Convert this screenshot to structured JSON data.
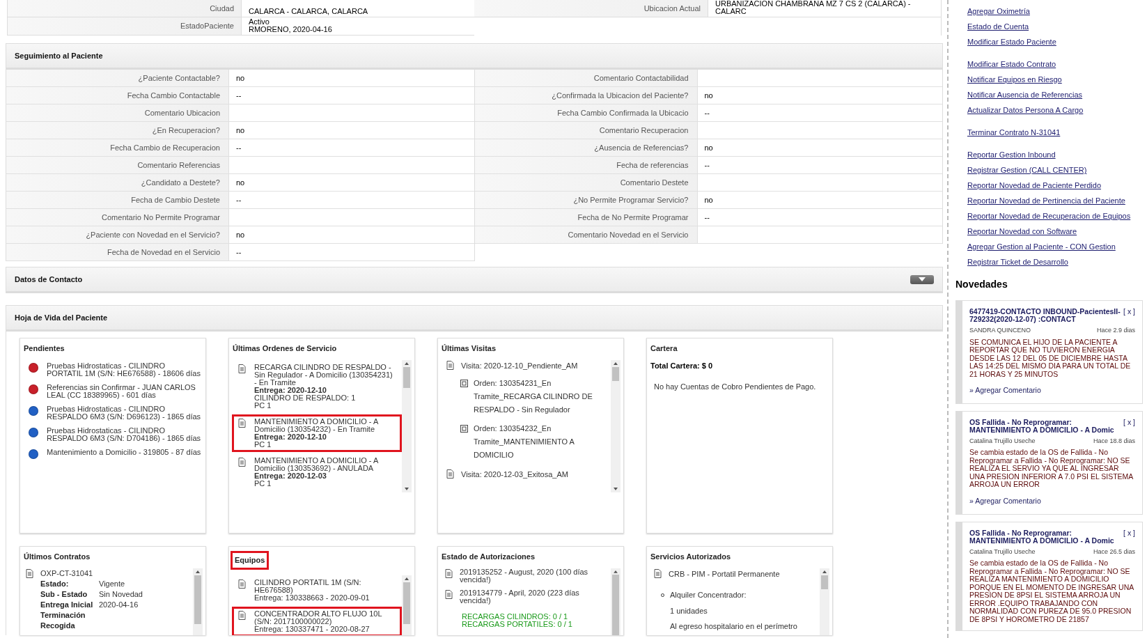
{
  "patient_info": {
    "rows": [
      {
        "left": {
          "label": "Ciudad",
          "value": [
            "CALARCA - CALARCA, CALARCA"
          ]
        },
        "right": {
          "label": "Ubicacion Actual",
          "value": [
            "URBANIZACION CHAMBRANA MZ 7 CS 2 (CALARCA) -",
            "CALARC"
          ]
        }
      },
      {
        "left": {
          "label": "EstadoPaciente",
          "value": [
            "Activo",
            "RMORENO, 2020-04-16"
          ]
        }
      }
    ]
  },
  "seguimiento": {
    "title": "Seguimiento al Paciente",
    "left": [
      {
        "label": "¿Paciente Contactable?",
        "value": "no"
      },
      {
        "label": "Fecha Cambio Contactable",
        "value": "--"
      },
      {
        "label": "Comentario Ubicacion"
      },
      {
        "label": "¿En Recuperacion?",
        "value": "no"
      },
      {
        "label": "Fecha Cambio de Recuperacion",
        "value": "--"
      },
      {
        "label": "Comentario Referencias"
      },
      {
        "label": "¿Candidato a Destete?",
        "value": "no"
      },
      {
        "label": "Fecha de Cambio Destete",
        "value": "--"
      },
      {
        "label": "Comentario No Permite Programar"
      },
      {
        "label": "¿Paciente con Novedad en el Servicio?",
        "value": "no"
      },
      {
        "label": "Fecha de Novedad en el Servicio",
        "value": "--"
      }
    ],
    "right": [
      {
        "label": "Comentario Contactabilidad"
      },
      {
        "label": "¿Confirmada la Ubicacion del Paciente?",
        "value": "no"
      },
      {
        "label": "Fecha Cambio Confirmada la Ubicacio",
        "value": "--"
      },
      {
        "label": "Comentario Recuperacion"
      },
      {
        "label": "¿Ausencia de Referencias?",
        "value": "no"
      },
      {
        "label": "Fecha de referencias",
        "value": "--"
      },
      {
        "label": "Comentario Destete"
      },
      {
        "label": "¿No Permite Programar Servicio?",
        "value": "no"
      },
      {
        "label": "Fecha de No Permite Programar",
        "value": "--"
      },
      {
        "label": "Comentario Novedad en el Servicio"
      }
    ]
  },
  "datos_contacto": {
    "title": "Datos de Contacto",
    "expanded": false
  },
  "hoja_de_vida": {
    "title": "Hoja de Vida del Paciente",
    "cards": [
      {
        "kind": "pendientes",
        "title": "Pendientes",
        "title_highlighted": false,
        "items": [
          {
            "text": "Pruebas Hidrostaticas - CILINDRO PORTATIL 1M (S/N: HE676588) - 18606 días",
            "color": "#c8202a"
          },
          {
            "text": "Referencias sin Confirmar - JUAN CARLOS LEAL (CC 18389965) - 601 días",
            "color": "#c8202a"
          },
          {
            "text": "Pruebas Hidrostaticas - CILINDRO RESPALDO 6M3 (S/N: D696123) - 1865 días",
            "color": "#2160c4"
          },
          {
            "text": "Pruebas Hidrostaticas - CILINDRO RESPALDO 6M3 (S/N: D704186) - 1865 días",
            "color": "#2160c4"
          },
          {
            "text": "Mantenimiento a Domicilio - 319805 - 87 días",
            "color": "#2160c4"
          }
        ]
      },
      {
        "kind": "ordenes",
        "title": "Últimas Ordenes de Servicio",
        "title_highlighted": false,
        "items": [
          {
            "highlighted": false,
            "lines": [
              {
                "text": "RECARGA CILINDRO DE RESPALDO - Sin Regulador - A Domicilio (130354231) - En Tramite",
                "bold": false
              },
              {
                "text": "Entrega: 2020-12-10",
                "bold": true
              },
              {
                "text": "CILINDRO DE RESPALDO: 1",
                "bold": false
              },
              {
                "text": "PC 1",
                "bold": false
              }
            ]
          },
          {
            "highlighted": true,
            "lines": [
              {
                "text": "MANTENIMIENTO A DOMICILIO - A Domicilio (130354232) - En Tramite",
                "bold": false
              },
              {
                "text": "Entrega: 2020-12-10",
                "bold": true
              },
              {
                "text": "PC 1",
                "bold": false
              }
            ]
          },
          {
            "highlighted": false,
            "lines": [
              {
                "text": "MANTENIMIENTO A DOMICILIO - A Domicilio (130353692) - ANULADA",
                "bold": false
              },
              {
                "text": "Entrega: 2020-12-03",
                "bold": true
              },
              {
                "text": "PC 1",
                "bold": false
              }
            ]
          }
        ]
      },
      {
        "kind": "visitas",
        "title": "Últimas Visitas",
        "title_highlighted": false,
        "items": [
          {
            "visit": "Visita: 2020-12-10_Pendiente_AM",
            "orders": [
              "Orden: 130354231_En Tramite_RECARGA CILINDRO DE RESPALDO - Sin Regulador",
              "Orden: 130354232_En Tramite_MANTENIMIENTO A DOMICILIO"
            ]
          },
          {
            "visit": "Visita: 2020-12-03_Exitosa_AM"
          }
        ]
      },
      {
        "kind": "cartera",
        "title": "Cartera",
        "title_highlighted": false,
        "total": "Total Cartera: $ 0",
        "note": "No hay Cuentas de Cobro Pendientes de Pago."
      },
      {
        "kind": "contratos",
        "title": "Últimos Contratos",
        "title_highlighted": false,
        "code": "OXP-CT-31041",
        "fields": [
          {
            "label": "Estado:",
            "value": "Vigente"
          },
          {
            "label": "Sub - Estado",
            "value": "Sin Novedad"
          },
          {
            "label": "Entrega Inicial",
            "value": "2020-04-16"
          },
          {
            "label": "Terminación Recogida"
          }
        ]
      },
      {
        "kind": "equipos",
        "title": "Equipos",
        "title_highlighted": true,
        "items": [
          {
            "highlighted": false,
            "lines": [
              {
                "text": "CILINDRO PORTATIL 1M (S/N: HE676588)",
                "bold": false
              },
              {
                "text": "Entrega: 130338663 - 2020-09-01",
                "bold": false
              }
            ]
          },
          {
            "highlighted": true,
            "lines": [
              {
                "text": "CONCENTRADOR ALTO FLUJO 10L (S/N: 2017100000022)",
                "bold": false
              },
              {
                "text": "Entrega: 130337471 - 2020-08-27",
                "bold": false
              }
            ]
          }
        ]
      },
      {
        "kind": "autorizaciones",
        "title": "Estado de Autorizaciones",
        "title_highlighted": false,
        "items": [
          "2019135252 - August, 2020 (100 días vencida!)",
          "2019134779 - April, 2020 (223 días vencida!)"
        ],
        "green_lines": [
          "RECARGAS CILINDROS: 0 / 1",
          "RECARGAS PORTATILES: 0 / 1"
        ]
      },
      {
        "kind": "servicios",
        "title": "Servicios Autorizados",
        "title_highlighted": false,
        "heading": "CRB - PIM - Portatil Permanente",
        "bullet": "Alquiler Concentrador:",
        "lines": [
          "1 unidades",
          "Al egreso hospitalario en el perímetro"
        ]
      }
    ]
  },
  "sidebar": {
    "link_groups": [
      [
        "Agregar Oximetría",
        "Estado de Cuenta",
        "Modificar Estado Paciente"
      ],
      [
        "Modificar Estado Contrato",
        "Notificar Equipos en Riesgo",
        "Notificar Ausencia de Referencias",
        "Actualizar Datos Persona A Cargo"
      ],
      [
        "Terminar Contrato N-31041"
      ],
      [
        "Reportar Gestion Inbound",
        "Registrar Gestion (CALL CENTER)",
        "Reportar Novedad de Paciente Perdido",
        "Reportar Novedad de Pertinencia del Paciente",
        "Reportar Novedad de Recuperacion de Equipos",
        "Reportar Novedad con Software",
        "Agregar Gestion al Paciente - CON Gestion",
        "Registrar Ticket de Desarrollo"
      ]
    ],
    "novedades": {
      "title": "Novedades",
      "items": [
        {
          "title": "6477419-CONTACTO INBOUND-PacientesII-729232(2020-12-07) :CONTACT",
          "close": "[ x ]",
          "author": "SANDRA QUINCENO",
          "age": "Hace 2.9 dias",
          "body": "SE COMUNICA EL HIJO DE LA PACIENTE A REPORTAR QUE NO TUVIERON ENERGIA DESDE LAS 12 DEL 05 DE DICIEMBRE HASTA LAS 14:25 DEL MISMO DIA PARA UN TOTAL DE 21 HORAS Y 25 MINUTOS",
          "action": "» Agregar Comentario"
        },
        {
          "title": "OS Fallida - No Reprogramar: MANTENIMIENTO A DOMICILIO - A Domic",
          "close": "[ x ]",
          "author": "Catalina Trujillo Useche",
          "age": "Hace 18.8 dias",
          "body": "Se cambia estado de la OS de Fallida - No Reprogramar a Fallida - No Reprogramar: NO SE REALIZA EL SERVIO YA QUE AL INGRESAR UNA PRESION INFERIOR A 7.0 PSI EL SISTEMA ARROJA UN ERROR",
          "action": "» Agregar Comentario"
        },
        {
          "title": "OS Fallida - No Reprogramar: MANTENIMIENTO A DOMICILIO - A Domic",
          "close": "[ x ]",
          "author": "Catalina Trujillo Useche",
          "age": "Hace 26.5 dias",
          "body": "Se cambia estado de la OS de Fallida - No Reprogramar a Fallida - No Reprogramar: NO SE REALIZA MANTENIMIENTO A DOMICILIO PORQUE EN EL MOMENTO DE INGRESAR UNA PRESION DE 8PSI EL SISTEMA ARROJA UN ERROR .EQUIPO TRABAJANDO CON NORMALIDAD CON PUREZA DE 95.0 PRESION DE 8PSI Y HOROMETRO DE 21857"
        }
      ]
    }
  }
}
